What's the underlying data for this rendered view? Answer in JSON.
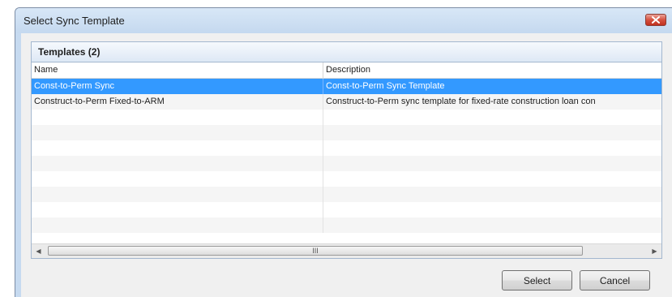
{
  "dialog": {
    "title": "Select Sync Template",
    "close_icon": "close-icon"
  },
  "panel": {
    "title": "Templates (2)",
    "columns": [
      "Name",
      "Description"
    ],
    "rows": [
      {
        "name": "Const-to-Perm Sync",
        "description": "Const-to-Perm Sync Template",
        "selected": true
      },
      {
        "name": "Construct-to-Perm Fixed-to-ARM",
        "description": "Construct-to-Perm sync template for fixed-rate construction loan con",
        "selected": false
      }
    ],
    "scrollbar": {
      "grip": "III",
      "left_icon": "scroll-left-icon",
      "right_icon": "scroll-right-icon"
    }
  },
  "buttons": {
    "select_label": "Select",
    "cancel_label": "Cancel"
  },
  "colors": {
    "selection": "#3399ff",
    "window_frame": "#c6daf0",
    "close_button": "#d6513f"
  }
}
